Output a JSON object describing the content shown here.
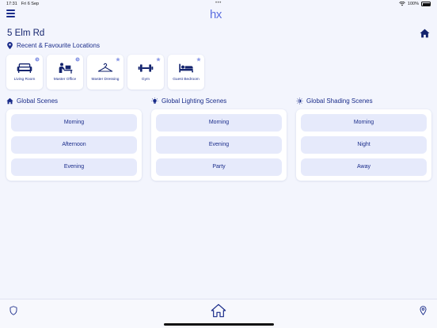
{
  "status": {
    "time": "17:31",
    "date": "Fri 6 Sep",
    "battery": "100%",
    "dots": "•••"
  },
  "app": {
    "logo": "hx"
  },
  "header": {
    "address": "5 Elm Rd"
  },
  "recent": {
    "title": "Recent & Favourite Locations",
    "items": [
      {
        "label": "Living Room",
        "icon": "sofa-icon",
        "badge": "recent-icon"
      },
      {
        "label": "Master Office",
        "icon": "desk-person-icon",
        "badge": "recent-icon"
      },
      {
        "label": "Master Dressing",
        "icon": "hanger-icon",
        "badge": "star-icon"
      },
      {
        "label": "Gym",
        "icon": "dumbbell-icon",
        "badge": "star-icon"
      },
      {
        "label": "Guest Bedroom",
        "icon": "bed-icon",
        "badge": "star-icon"
      }
    ]
  },
  "scenes": [
    {
      "title": "Global Scenes",
      "icon": "home-icon",
      "buttons": [
        "Morning",
        "Afternoon",
        "Evening"
      ]
    },
    {
      "title": "Global Lighting Scenes",
      "icon": "lightbulb-icon",
      "buttons": [
        "Morning",
        "Evening",
        "Party"
      ]
    },
    {
      "title": "Global Shading Scenes",
      "icon": "shade-sun-icon",
      "buttons": [
        "Morning",
        "Night",
        "Away"
      ]
    }
  ],
  "colors": {
    "primary": "#1a2c8a",
    "accent": "#5b6ee0",
    "background": "#f3f5fd",
    "button": "#e6eafb"
  }
}
